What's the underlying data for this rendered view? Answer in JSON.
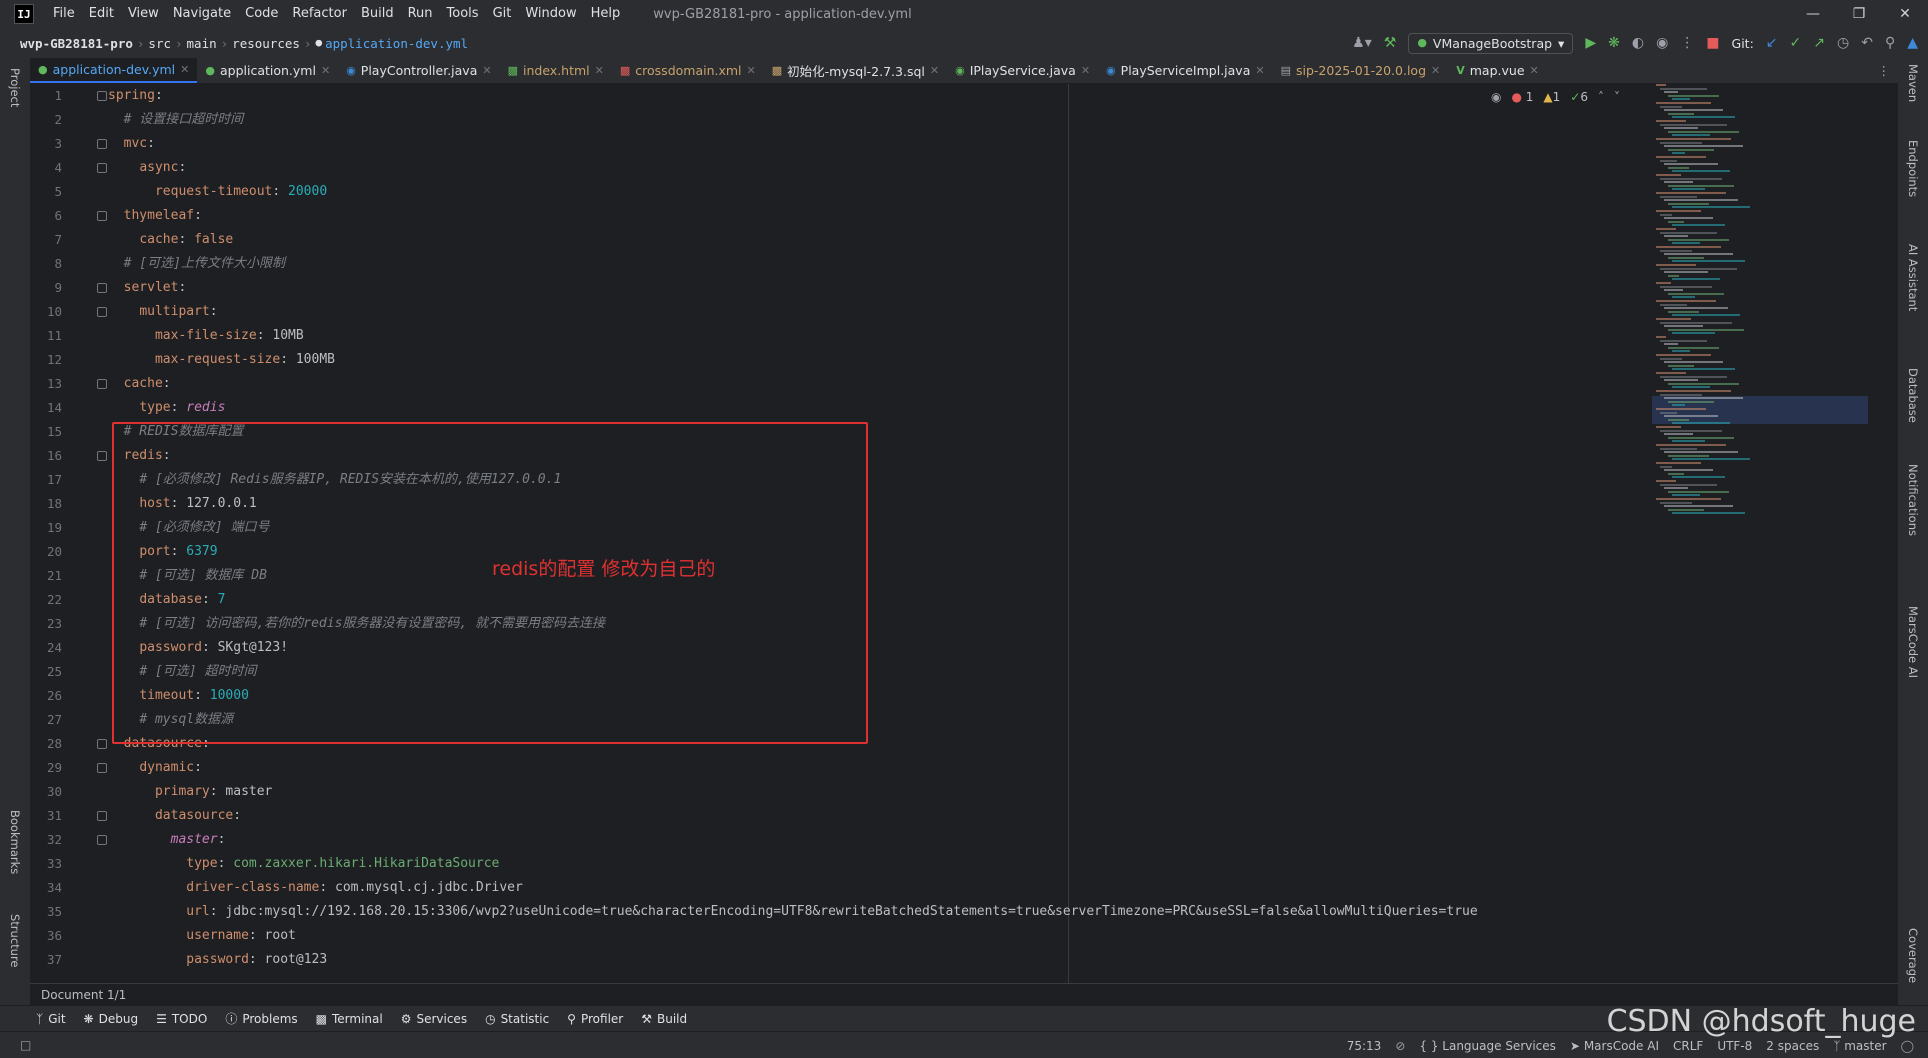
{
  "window": {
    "title": "wvp-GB28181-pro - application-dev.yml",
    "logo": "IJ",
    "menu": [
      "File",
      "Edit",
      "View",
      "Navigate",
      "Code",
      "Refactor",
      "Build",
      "Run",
      "Tools",
      "Git",
      "Window",
      "Help"
    ]
  },
  "breadcrumb": [
    "wvp-GB28181-pro",
    "src",
    "main",
    "resources",
    "application-dev.yml"
  ],
  "toolbar": {
    "run_config": "VManageBootstrap",
    "git_label": "Git:"
  },
  "tabs": [
    {
      "label": "application-dev.yml",
      "icon": "yaml-icon",
      "active": true
    },
    {
      "label": "application.yml",
      "icon": "yaml-icon"
    },
    {
      "label": "PlayController.java",
      "icon": "class-icon"
    },
    {
      "label": "index.html",
      "icon": "html-icon",
      "warn": true
    },
    {
      "label": "crossdomain.xml",
      "icon": "xml-icon",
      "warn": true
    },
    {
      "label": "初始化-mysql-2.7.3.sql",
      "icon": "sql-icon"
    },
    {
      "label": "IPlayService.java",
      "icon": "interface-icon"
    },
    {
      "label": "PlayServiceImpl.java",
      "icon": "class-icon"
    },
    {
      "label": "sip-2025-01-20.0.log",
      "icon": "log-icon",
      "warn": true
    },
    {
      "label": "map.vue",
      "icon": "vue-icon"
    }
  ],
  "inspections": {
    "errors": "1",
    "warnings": "1",
    "ok": "6"
  },
  "annotation": "redis的配置  修改为自己的",
  "code_lines": [
    "spring:",
    "  # 设置接口超时时间",
    "  mvc:",
    "    async:",
    "      request-timeout: 20000",
    "  thymeleaf:",
    "    cache: false",
    "  # [可选]上传文件大小限制",
    "  servlet:",
    "    multipart:",
    "      max-file-size: 10MB",
    "      max-request-size: 100MB",
    "  cache:",
    "    type: redis",
    "  # REDIS数据库配置",
    "  redis:",
    "    # [必须修改] Redis服务器IP, REDIS安装在本机的,使用127.0.0.1",
    "    host: 127.0.0.1",
    "    # [必须修改] 端口号",
    "    port: 6379",
    "    # [可选] 数据库 DB",
    "    database: 7",
    "    # [可选] 访问密码,若你的redis服务器没有设置密码, 就不需要用密码去连接",
    "    password: SKgt@123!",
    "    # [可选] 超时时间",
    "    timeout: 10000",
    "    # mysql数据源",
    "  datasource:",
    "    dynamic:",
    "      primary: master",
    "      datasource:",
    "        master:",
    "          type: com.zaxxer.hikari.HikariDataSource",
    "          driver-class-name: com.mysql.cj.jdbc.Driver",
    "          url: jdbc:mysql://192.168.20.15:3306/wvp2?useUnicode=true&characterEncoding=UTF8&rewriteBatchedStatements=true&serverTimezone=PRC&useSSL=false&allowMultiQueries=true",
    "          username: root",
    "          password: root@123"
  ],
  "left_tools": [
    "Project",
    "Bookmarks",
    "Structure"
  ],
  "right_tools": [
    "Maven",
    "Endpoints",
    "AI Assistant",
    "Database",
    "Notifications",
    "MarsCode AI",
    "Coverage"
  ],
  "doc_status": "Document 1/1",
  "tool_windows": [
    "Git",
    "Debug",
    "TODO",
    "Problems",
    "Terminal",
    "Services",
    "Statistic",
    "Profiler",
    "Build"
  ],
  "status": {
    "position": "75:13",
    "language_services": "Language Services",
    "marscode": "MarsCode AI",
    "line_sep": "CRLF",
    "encoding": "UTF-8",
    "indent": "2 spaces",
    "branch": "master"
  },
  "watermark": "CSDN @hdsoft_huge"
}
